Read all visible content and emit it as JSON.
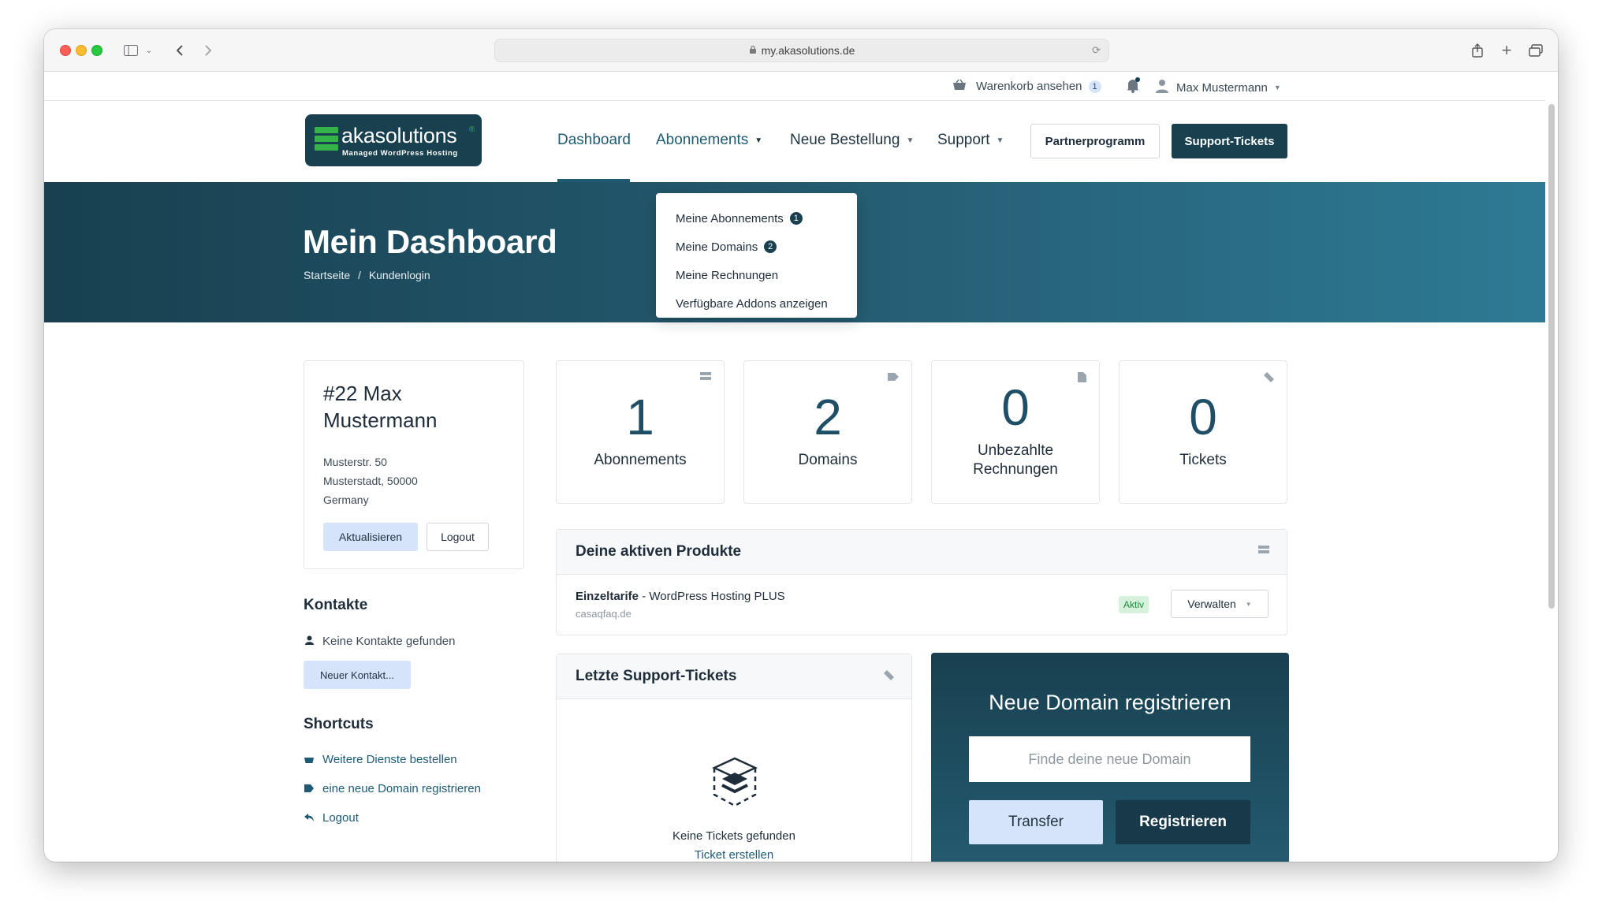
{
  "browser": {
    "url": "my.akasolutions.de"
  },
  "topbar": {
    "cart_label": "Warenkorb ansehen",
    "cart_count": "1",
    "user_name": "Max Mustermann"
  },
  "logo": {
    "name": "akasolutions",
    "tagline": "Managed WordPress Hosting",
    "reg": "®"
  },
  "nav": {
    "dashboard": "Dashboard",
    "abonnements": "Abonnements",
    "neue_bestellung": "Neue Bestellung",
    "support": "Support",
    "partner": "Partnerprogramm",
    "tickets": "Support-Tickets"
  },
  "hero": {
    "title": "Mein Dashboard",
    "crumb_home": "Startseite",
    "crumb_sep": "/",
    "crumb_current": "Kundenlogin"
  },
  "dropdown": {
    "items": [
      {
        "label": "Meine Abonnements",
        "badge": "1"
      },
      {
        "label": "Meine Domains",
        "badge": "2"
      },
      {
        "label": "Meine Rechnungen"
      },
      {
        "label": "Verfügbare Addons anzeigen"
      }
    ]
  },
  "profile": {
    "name": "#22 Max Mustermann",
    "street": "Musterstr. 50",
    "city": "Musterstadt, 50000",
    "country": "Germany",
    "update_label": "Aktualisieren",
    "logout_label": "Logout"
  },
  "contacts": {
    "title": "Kontakte",
    "empty": "Keine Kontakte gefunden",
    "new_label": "Neuer Kontakt..."
  },
  "shortcuts": {
    "title": "Shortcuts",
    "items": [
      "Weitere Dienste bestellen",
      "eine neue Domain registrieren",
      "Logout"
    ]
  },
  "stats": [
    {
      "value": "1",
      "label": "Abonnements"
    },
    {
      "value": "2",
      "label": "Domains"
    },
    {
      "value": "0",
      "label": "Unbezahlte Rechnungen"
    },
    {
      "value": "0",
      "label": "Tickets"
    }
  ],
  "products": {
    "title": "Deine aktiven Produkte",
    "items": [
      {
        "group": "Einzeltarife",
        "sep": " - ",
        "name": "WordPress Hosting PLUS",
        "domain": "casaqfaq.de",
        "status": "Aktiv",
        "action": "Verwalten"
      }
    ]
  },
  "tickets": {
    "title": "Letzte Support-Tickets",
    "empty": "Keine Tickets gefunden",
    "create": "Ticket erstellen"
  },
  "domain": {
    "title": "Neue Domain registrieren",
    "placeholder": "Finde deine neue Domain",
    "transfer": "Transfer",
    "register": "Registrieren"
  },
  "colors": {
    "brand_dark": "#18404f",
    "accent": "#1e5a73",
    "active_green": "#1f8a3a",
    "light_button": "#d6e4fb"
  }
}
